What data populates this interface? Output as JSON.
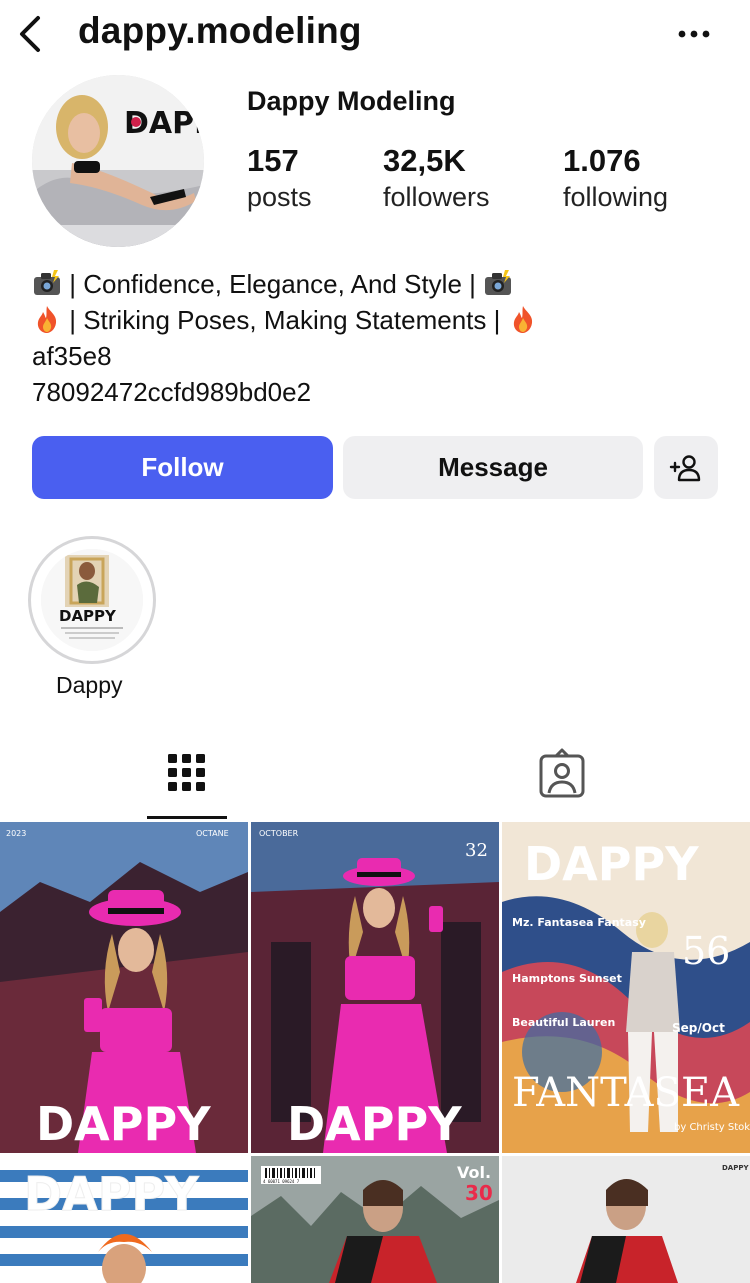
{
  "header": {
    "username": "dappy.modeling",
    "back_icon": "chevron-left-icon",
    "more_icon": "more-horizontal-icon"
  },
  "profile": {
    "display_name": "Dappy Modeling",
    "avatar_logo_text": "DAPI",
    "stats": {
      "posts": {
        "value": "157",
        "label": "posts"
      },
      "followers": {
        "value": "32,5K",
        "label": "followers"
      },
      "following": {
        "value": "1.076",
        "label": "following"
      }
    },
    "bio": {
      "line1": " | Confidence, Elegance, And Style | ",
      "line2": " | Striking Poses, Making Statements | ",
      "line3": "af35e8",
      "line4": "78092472ccfd989bd0e2"
    }
  },
  "actions": {
    "follow_label": "Follow",
    "message_label": "Message",
    "add_user_icon": "add-user-icon"
  },
  "highlights": [
    {
      "label": "Dappy",
      "logo_text": "DAPPY"
    }
  ],
  "tabs": [
    {
      "name": "grid",
      "icon": "grid-icon",
      "active": true
    },
    {
      "name": "tagged",
      "icon": "tagged-icon",
      "active": false
    }
  ],
  "posts": [
    {
      "logo": "DAPPY",
      "corner_left": "2023",
      "corner_right": "OCTANE"
    },
    {
      "logo": "DAPPY",
      "corner_left": "OCTOBER",
      "issue": "32"
    },
    {
      "logo": "DAPPY",
      "big_number": "56",
      "lines": [
        "Mz. Fantasea Fantasy",
        "Hamptons Sunset",
        "Beautiful Lauren"
      ],
      "date": "Sep/Oct",
      "title": "FANTASEA",
      "credit": "by Christy Stokes"
    },
    {
      "logo": "DAPPY"
    },
    {
      "vol_label": "Vol.",
      "vol_number": "30",
      "barcode_text": "4 60071 09624 7"
    },
    {
      "logo": "DAPPY"
    }
  ],
  "colors": {
    "follow_button": "#4a5ff0",
    "secondary_button": "#efeff1",
    "pink": "#e92bb0"
  }
}
